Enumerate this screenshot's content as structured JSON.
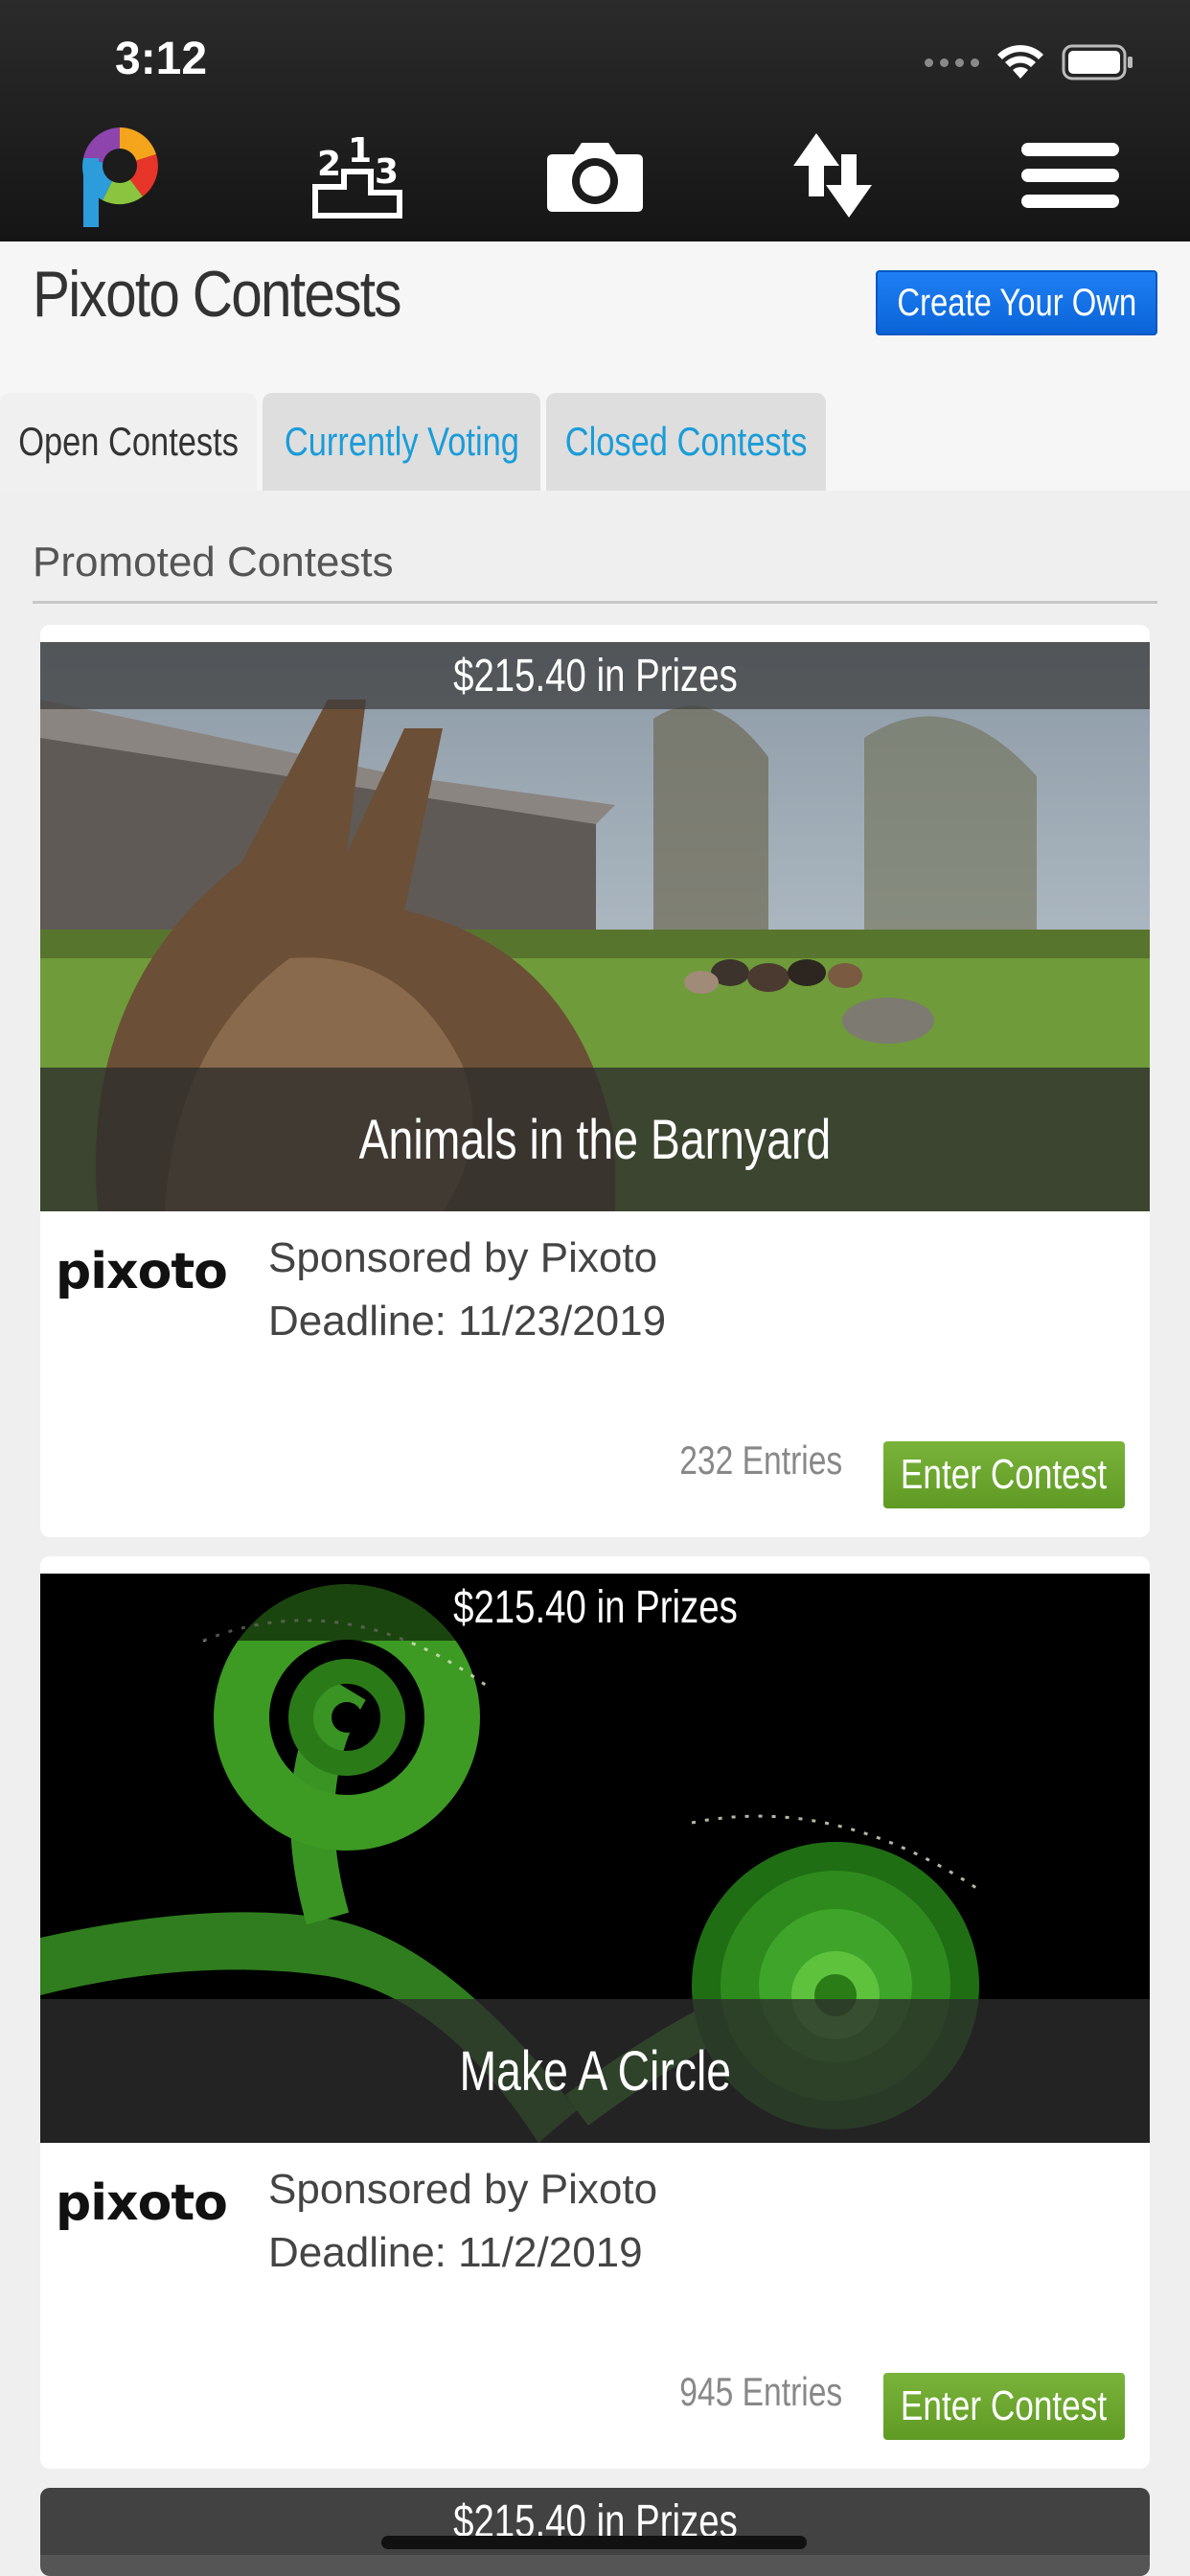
{
  "status": {
    "time": "3:12"
  },
  "nav": {
    "icons": [
      "pixoto-logo-icon",
      "leaderboard-icon",
      "camera-icon",
      "sort-icon",
      "menu-icon"
    ]
  },
  "header": {
    "title": "Pixoto Contests",
    "create_button": "Create Your Own"
  },
  "tabs": [
    {
      "label": "Open Contests",
      "active": true
    },
    {
      "label": "Currently Voting",
      "active": false
    },
    {
      "label": "Closed Contests",
      "active": false
    }
  ],
  "section": {
    "heading": "Promoted Contests"
  },
  "contests": [
    {
      "prize": "$215.40 in Prizes",
      "title": "Animals in the Barnyard",
      "sponsor_logo": "pixoto",
      "sponsor": "Sponsored by Pixoto",
      "deadline": "Deadline: 11/23/2019",
      "entries": "232 Entries",
      "enter_label": "Enter Contest"
    },
    {
      "prize": "$215.40 in Prizes",
      "title": "Make A Circle",
      "sponsor_logo": "pixoto",
      "sponsor": "Sponsored by Pixoto",
      "deadline": "Deadline: 11/2/2019",
      "entries": "945 Entries",
      "enter_label": "Enter Contest"
    },
    {
      "prize": "$215.40 in Prizes"
    }
  ],
  "colors": {
    "accent_blue": "#0a64d8",
    "tab_link": "#1a9cd8",
    "enter_green": "#6aa62d"
  }
}
